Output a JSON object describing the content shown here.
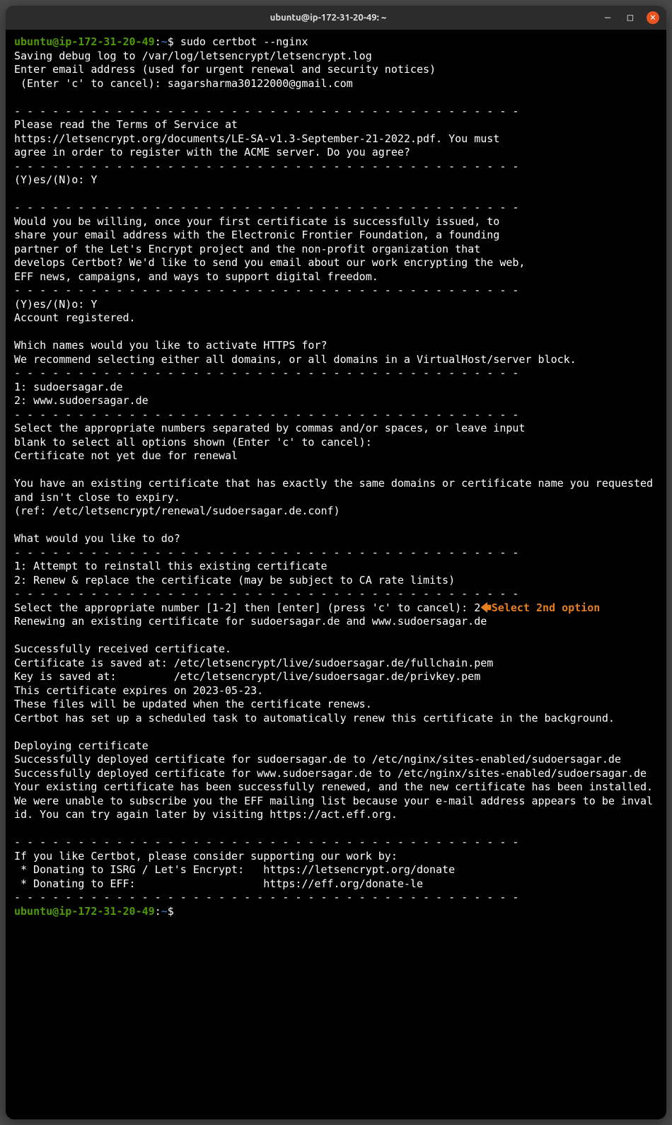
{
  "window": {
    "title": "ubuntu@ip-172-31-20-49: ~"
  },
  "prompt": {
    "user_host": "ubuntu@ip-172-31-20-49",
    "colon": ":",
    "path": "~",
    "dollar": "$"
  },
  "command": "sudo certbot --nginx",
  "lines": {
    "l1": "Saving debug log to /var/log/letsencrypt/letsencrypt.log",
    "l2": "Enter email address (used for urgent renewal and security notices)",
    "l3": " (Enter 'c' to cancel): sagarsharma30122000@gmail.com",
    "sep": "- - - - - - - - - - - - - - - - - - - - - - - - - - - - - - - - - - - - - - - -",
    "l4": "Please read the Terms of Service at",
    "l5": "https://letsencrypt.org/documents/LE-SA-v1.3-September-21-2022.pdf. You must",
    "l6": "agree in order to register with the ACME server. Do you agree?",
    "l7": "(Y)es/(N)o: Y",
    "l8": "Would you be willing, once your first certificate is successfully issued, to",
    "l9": "share your email address with the Electronic Frontier Foundation, a founding",
    "l10": "partner of the Let's Encrypt project and the non-profit organization that",
    "l11": "develops Certbot? We'd like to send you email about our work encrypting the web,",
    "l12": "EFF news, campaigns, and ways to support digital freedom.",
    "l13": "(Y)es/(N)o: Y",
    "l14": "Account registered.",
    "l15": "Which names would you like to activate HTTPS for?",
    "l16": "We recommend selecting either all domains, or all domains in a VirtualHost/server block.",
    "l17": "1: sudoersagar.de",
    "l18": "2: www.sudoersagar.de",
    "l19": "Select the appropriate numbers separated by commas and/or spaces, or leave input",
    "l20": "blank to select all options shown (Enter 'c' to cancel): ",
    "l21": "Certificate not yet due for renewal",
    "l22": "You have an existing certificate that has exactly the same domains or certificate name you requested and isn't close to expiry.",
    "l23": "(ref: /etc/letsencrypt/renewal/sudoersagar.de.conf)",
    "l24": "What would you like to do?",
    "l25": "1: Attempt to reinstall this existing certificate",
    "l26": "2: Renew & replace the certificate (may be subject to CA rate limits)",
    "l27": "Select the appropriate number [1-2] then [enter] (press 'c' to cancel): 2",
    "l28": "Renewing an existing certificate for sudoersagar.de and www.sudoersagar.de",
    "l29": "Successfully received certificate.",
    "l30": "Certificate is saved at: /etc/letsencrypt/live/sudoersagar.de/fullchain.pem",
    "l31": "Key is saved at:         /etc/letsencrypt/live/sudoersagar.de/privkey.pem",
    "l32": "This certificate expires on 2023-05-23.",
    "l33": "These files will be updated when the certificate renews.",
    "l34": "Certbot has set up a scheduled task to automatically renew this certificate in the background.",
    "l35": "Deploying certificate",
    "l36": "Successfully deployed certificate for sudoersagar.de to /etc/nginx/sites-enabled/sudoersagar.de",
    "l37": "Successfully deployed certificate for www.sudoersagar.de to /etc/nginx/sites-enabled/sudoersagar.de",
    "l38": "Your existing certificate has been successfully renewed, and the new certificate has been installed.",
    "l39": "We were unable to subscribe you the EFF mailing list because your e-mail address appears to be invalid. You can try again later by visiting https://act.eff.org.",
    "l40": "If you like Certbot, please consider supporting our work by:",
    "l41": " * Donating to ISRG / Let's Encrypt:   https://letsencrypt.org/donate",
    "l42": " * Donating to EFF:                    https://eff.org/donate-le"
  },
  "annotation": {
    "arrow": "🡄",
    "text": "Select 2nd option"
  }
}
